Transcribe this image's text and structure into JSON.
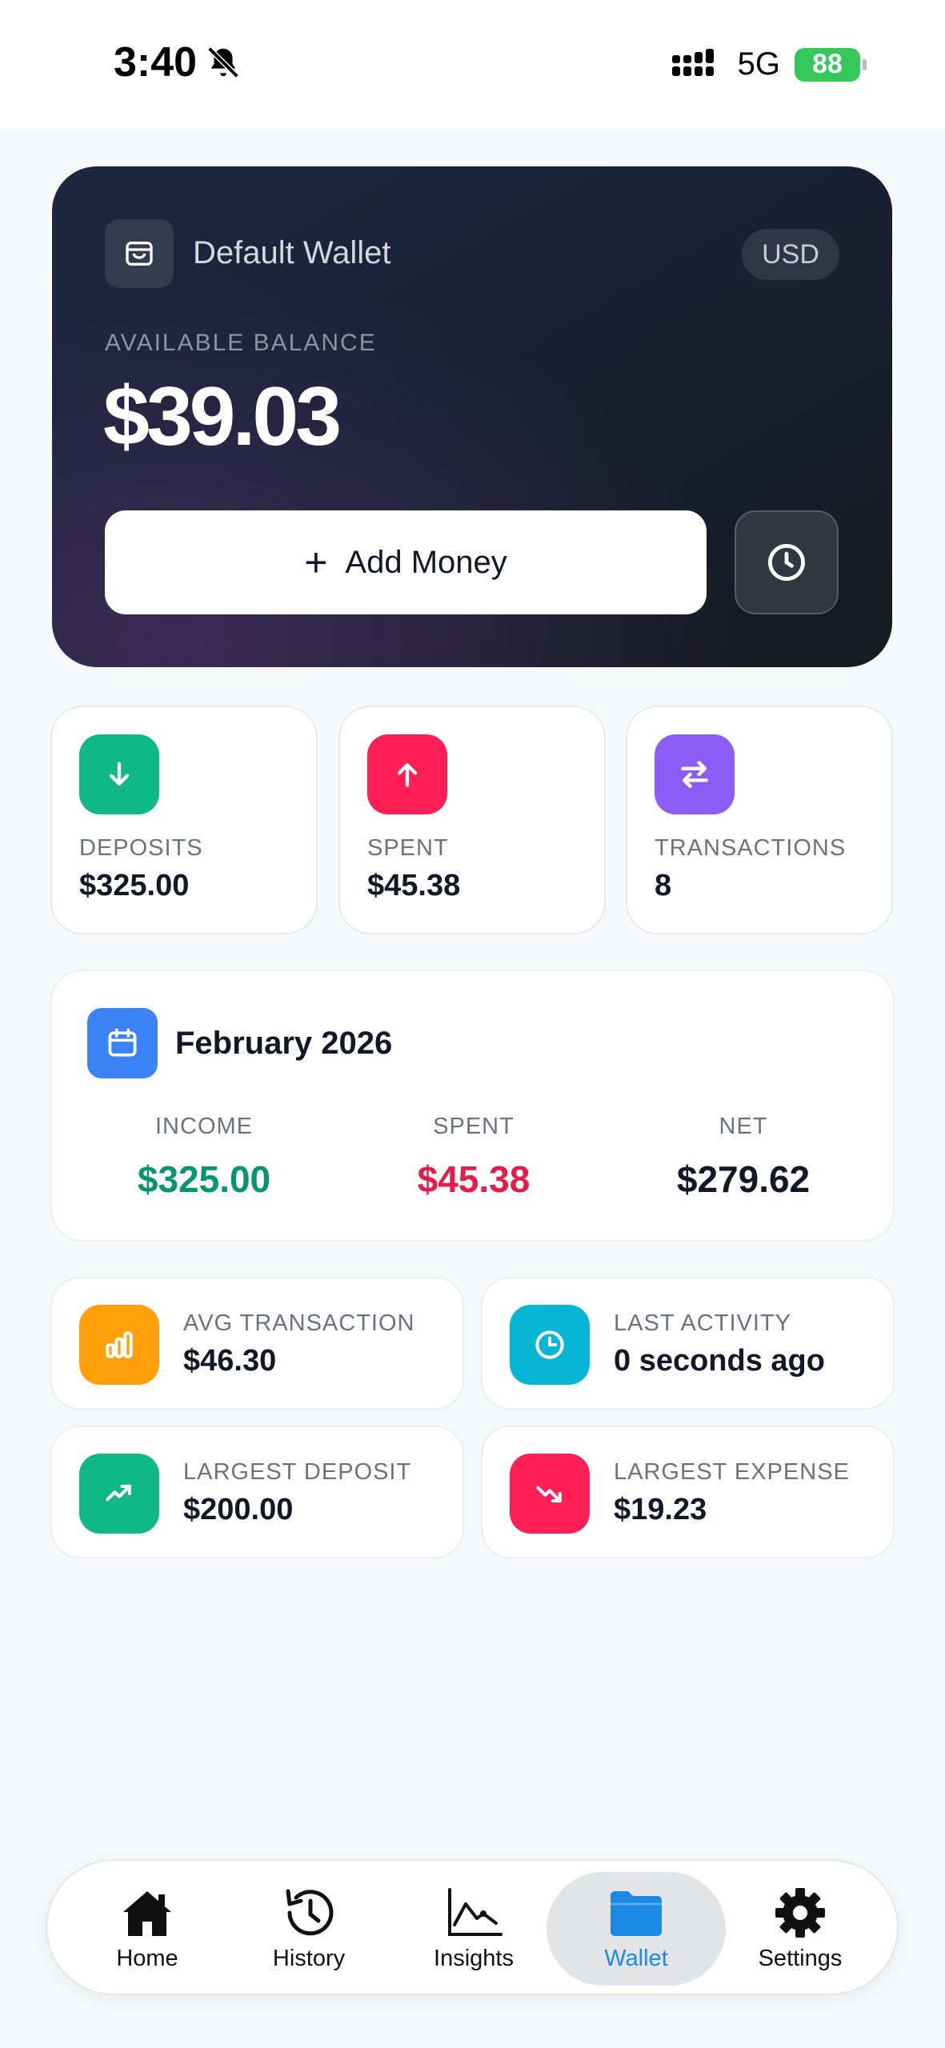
{
  "status_bar": {
    "time": "3:40",
    "network": "5G",
    "battery": "88"
  },
  "wallet": {
    "name": "Default Wallet",
    "currency": "USD",
    "balance_label": "AVAILABLE BALANCE",
    "balance": "$39.03",
    "add_money_label": "Add Money"
  },
  "stats": [
    {
      "label": "DEPOSITS",
      "value": "$325.00",
      "color": "#10b981",
      "icon": "arrow-down-icon"
    },
    {
      "label": "SPENT",
      "value": "$45.38",
      "color": "#ff1f55",
      "icon": "arrow-up-icon"
    },
    {
      "label": "TRANSACTIONS",
      "value": "8",
      "color": "#8b5cf6",
      "icon": "swap-arrows-icon"
    }
  ],
  "month": {
    "title": "February 2026",
    "income_label": "INCOME",
    "income_value": "$325.00",
    "spent_label": "SPENT",
    "spent_value": "$45.38",
    "net_label": "NET",
    "net_value": "$279.62"
  },
  "metrics": [
    {
      "label": "AVG TRANSACTION",
      "value": "$46.30",
      "color": "#ff9f0a",
      "icon": "bar-chart-icon"
    },
    {
      "label": "LAST ACTIVITY",
      "value": "0 seconds ago",
      "color": "#06b6d4",
      "icon": "clock-icon"
    },
    {
      "label": "LARGEST DEPOSIT",
      "value": "$200.00",
      "color": "#10b981",
      "icon": "trend-up-icon"
    },
    {
      "label": "LARGEST EXPENSE",
      "value": "$19.23",
      "color": "#ff1f55",
      "icon": "trend-down-icon"
    }
  ],
  "nav": {
    "items": [
      {
        "label": "Home",
        "icon": "home-icon"
      },
      {
        "label": "History",
        "icon": "history-icon"
      },
      {
        "label": "Insights",
        "icon": "chart-line-icon"
      },
      {
        "label": "Wallet",
        "icon": "folder-icon",
        "active": true
      },
      {
        "label": "Settings",
        "icon": "gear-icon"
      }
    ],
    "active_color": "#1e88e5"
  }
}
